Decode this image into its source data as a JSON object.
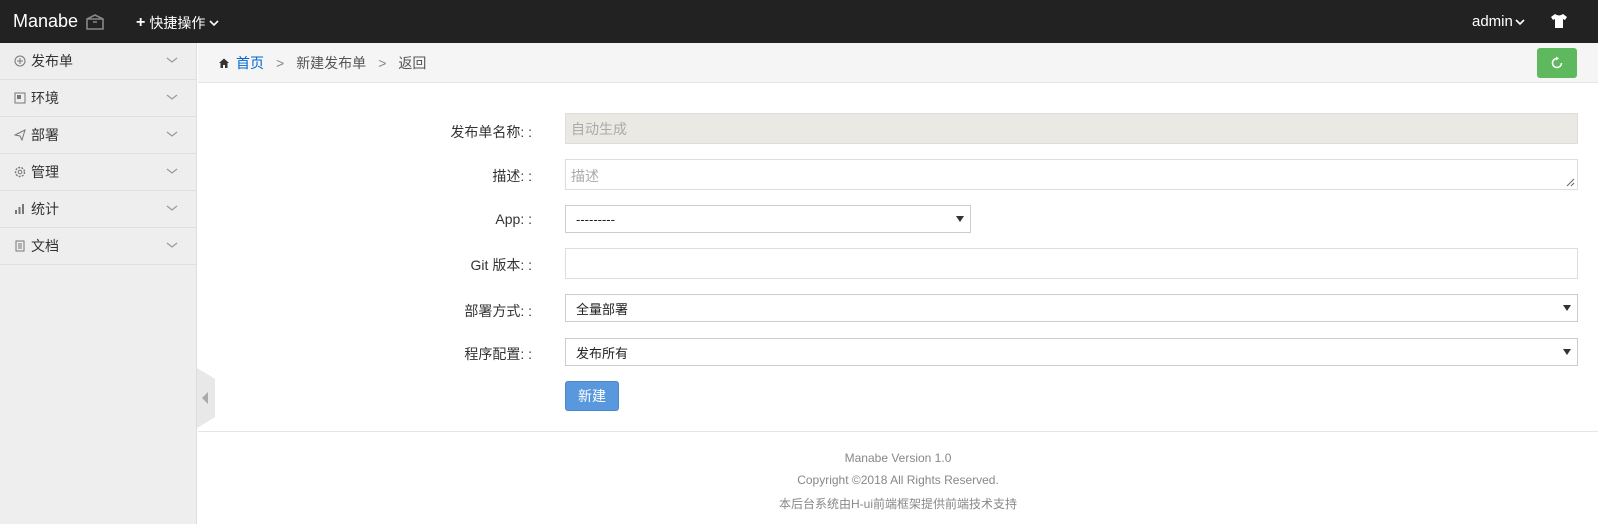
{
  "header": {
    "brand": "Manabe",
    "quick_actions": "快捷操作",
    "user": "admin"
  },
  "sidebar": {
    "items": [
      {
        "label": "发布单",
        "icon": "plus-circle-icon"
      },
      {
        "label": "环境",
        "icon": "environment-icon"
      },
      {
        "label": "部署",
        "icon": "paper-plane-icon"
      },
      {
        "label": "管理",
        "icon": "gear-icon"
      },
      {
        "label": "统计",
        "icon": "bar-chart-icon"
      },
      {
        "label": "文档",
        "icon": "document-icon"
      }
    ]
  },
  "breadcrumb": {
    "home": "首页",
    "separator": ">",
    "current": "新建发布单",
    "back": "返回"
  },
  "form": {
    "name_label": "发布单名称: :",
    "name_value": "自动生成",
    "desc_label": "描述: :",
    "desc_placeholder": "描述",
    "app_label": "App: :",
    "app_value": "---------",
    "git_label": "Git 版本: :",
    "git_value": "",
    "deploy_label": "部署方式: :",
    "deploy_value": "全量部署",
    "config_label": "程序配置: :",
    "config_value": "发布所有",
    "submit": "新建"
  },
  "footer": {
    "version": "Manabe Version 1.0",
    "copyright": "Copyright ©2018 All Rights Reserved.",
    "support": "本后台系统由H-ui前端框架提供前端技术支持"
  },
  "colors": {
    "topbar": "#222222",
    "sidebar": "#eeeeee",
    "primary_button": "#5a98de",
    "refresh_button": "#5eb95e",
    "link": "#0066cc"
  }
}
